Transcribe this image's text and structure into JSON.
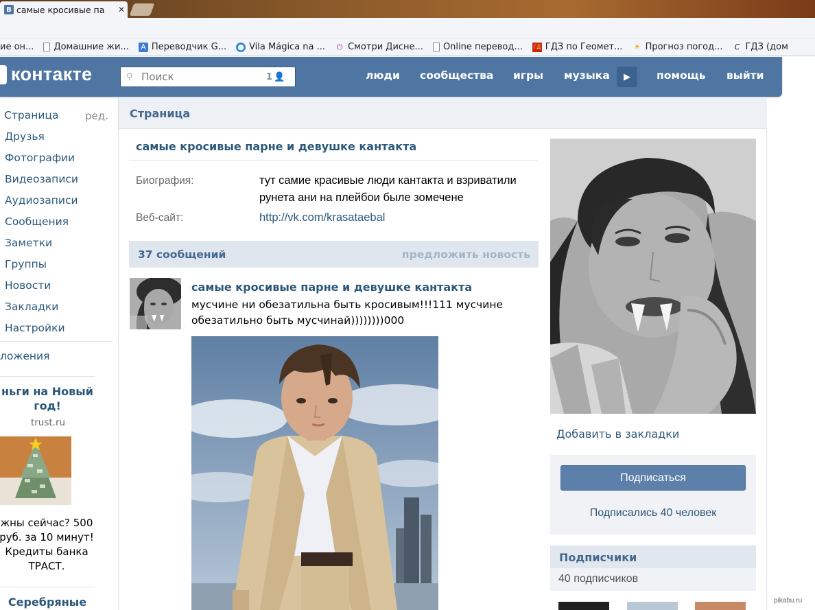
{
  "browser": {
    "tab_title": "самые кросивые па",
    "tab_favicon": "B",
    "bookmarks": [
      {
        "icon": "doc-icon",
        "label": "ие он..."
      },
      {
        "icon": "doc-icon",
        "label": "Домашние жи..."
      },
      {
        "icon": "translate-icon",
        "label": "Переводчик G..."
      },
      {
        "icon": "globe-icon",
        "label": "Vila Mágica na ..."
      },
      {
        "icon": "power-icon",
        "label": "Смотри Дисне..."
      },
      {
        "icon": "doc-icon",
        "label": "Online перевод..."
      },
      {
        "icon": "book-icon",
        "label": "ГДЗ по Геомет..."
      },
      {
        "icon": "weather-icon",
        "label": "Прогноз погод..."
      },
      {
        "icon": "c-icon",
        "label": "ГДЗ (дом"
      }
    ]
  },
  "header": {
    "logo": "контакте",
    "search_placeholder": "Поиск",
    "search_count": "1",
    "nav": [
      "люди",
      "сообщества",
      "игры",
      "музыка",
      "помощь",
      "выйти"
    ]
  },
  "left_menu": {
    "items": [
      "Страница",
      "Друзья",
      "Фотографии",
      "Видеозаписи",
      "Аудиозаписи",
      "Сообщения",
      "Заметки",
      "Группы",
      "Новости",
      "Закладки",
      "Настройки"
    ],
    "edit_label": "ред.",
    "apps_label": "ложения",
    "ad": {
      "title": "ньги на Новый год!",
      "domain": "trust.ru",
      "text": "жны сейчас? 500 руб. за 10 минут! Кредиты банка ТРАСТ."
    },
    "ad2_title": "Серебряные"
  },
  "page": {
    "header": "Страница",
    "group_title": "самые кросивые парне и девушке кантакта",
    "bio_label": "Биография:",
    "bio_value": "тут самие красивые люди кантакта и взриватили рунета ани на плейбои быле зомечене",
    "site_label": "Веб-сайт:",
    "site_value": "http://vk.com/krasataebal",
    "wall_count": "37 сообщений",
    "wall_suggest": "предложить новость",
    "post": {
      "author": "самые кросивые парне и девушке кантакта",
      "text": "мусчине ни обезатильна быть кросивым!!!111 мусчине обезатильно быть мусчинай))))))))000"
    }
  },
  "sidebar": {
    "add_bookmark": "Добавить в закладки",
    "subscribe_button": "Подписаться",
    "subscribed_count": "Подписались 40 человек",
    "followers_header": "Подписчики",
    "followers_count": "40 подписчиков"
  },
  "watermark": "pikabu.ru"
}
